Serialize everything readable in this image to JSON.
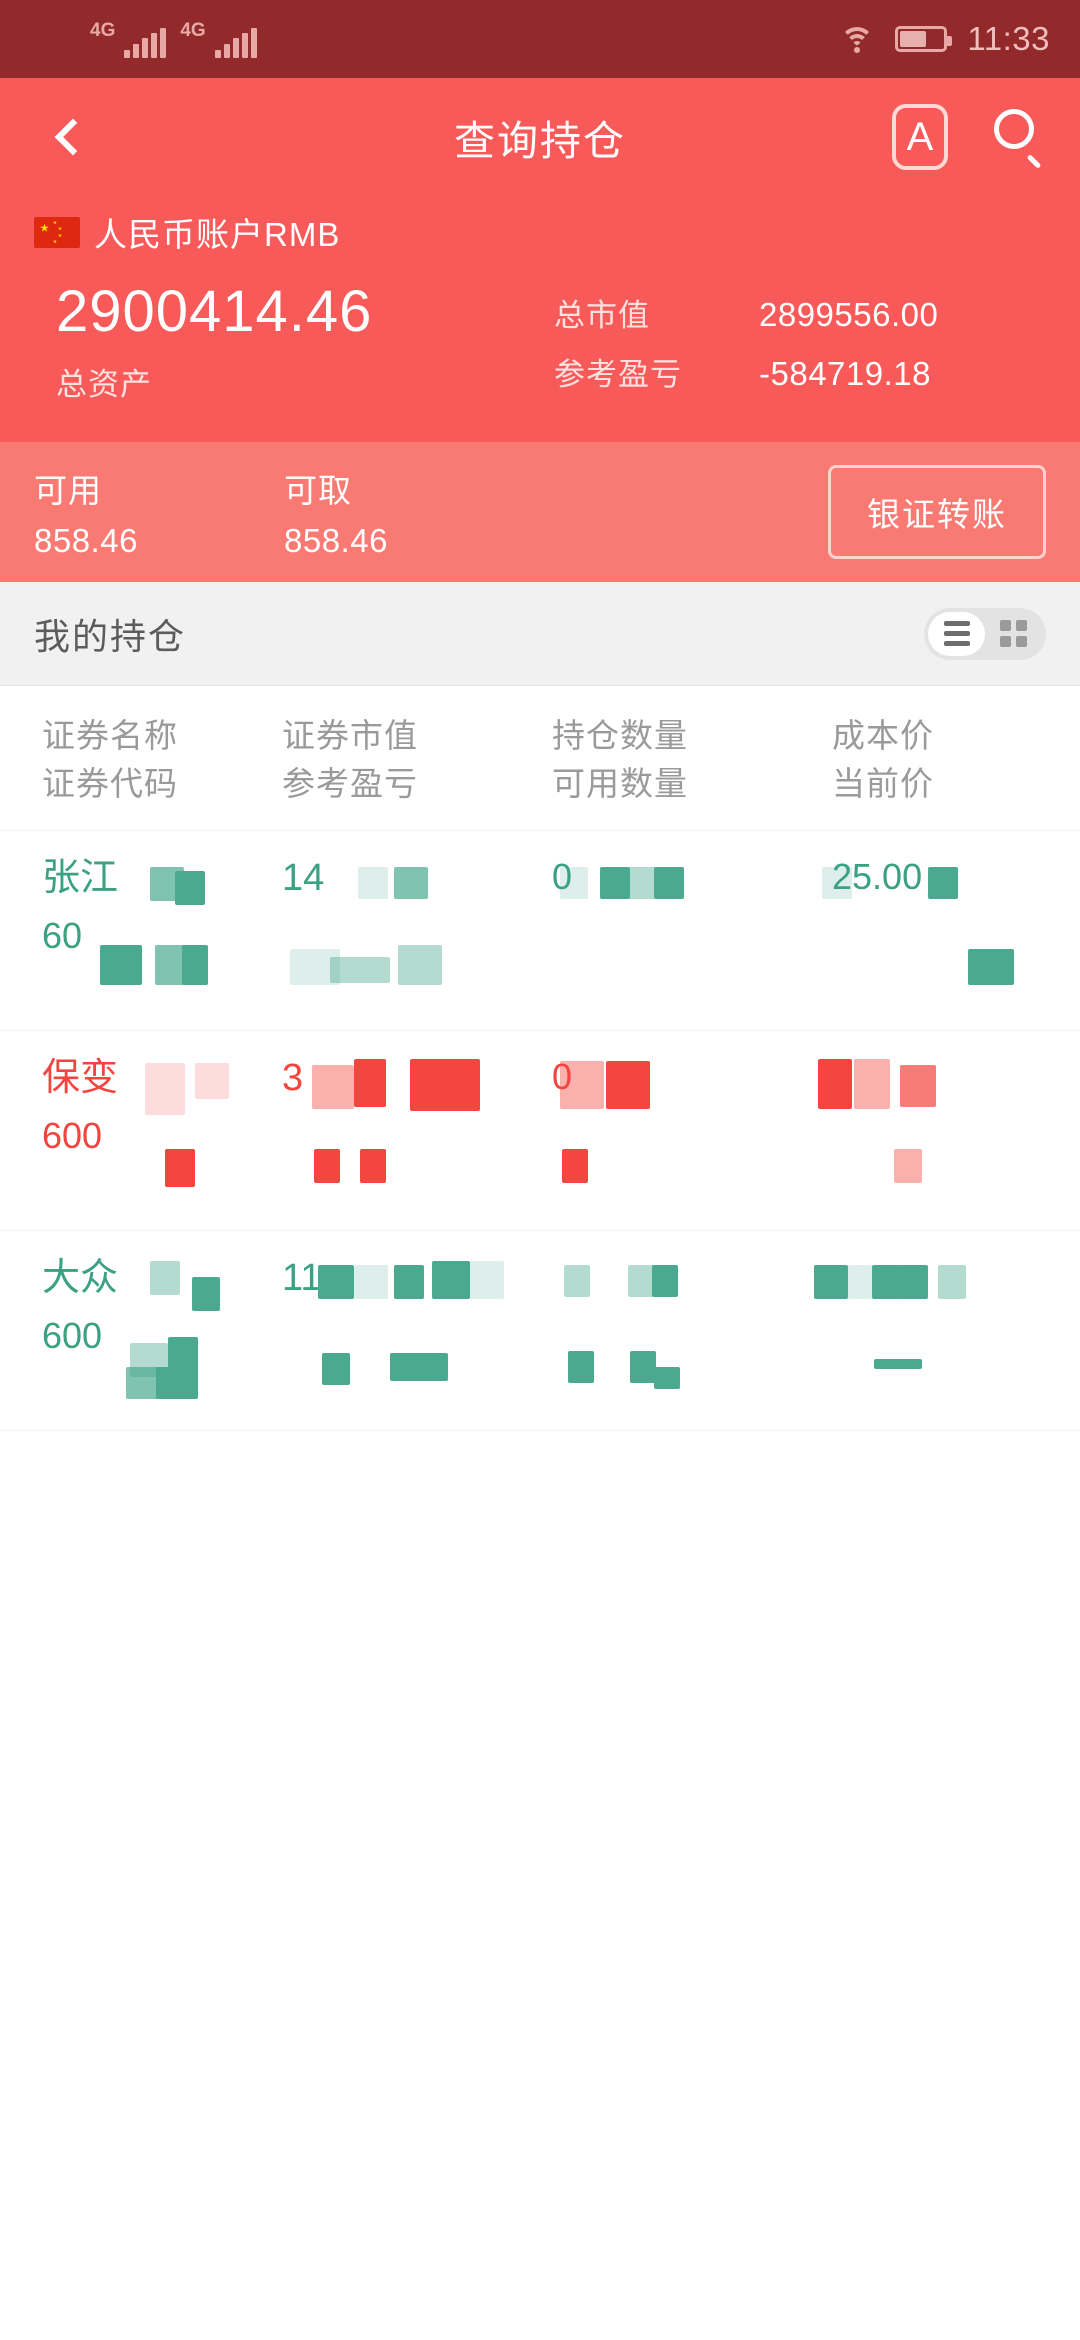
{
  "status_bar": {
    "network_1": "4G",
    "network_2": "4G",
    "wifi_icon": "wifi-icon",
    "battery_icon": "battery-icon",
    "time": "11:33"
  },
  "header": {
    "back_icon": "back-chevron-icon",
    "title": "查询持仓",
    "font_size_icon": "letter-a-icon",
    "font_size_label": "A",
    "search_icon": "search-icon",
    "background_color": "#f75a58"
  },
  "account": {
    "flag_icon": "china-flag-icon",
    "name": "人民币账户RMB",
    "total_assets_value": "2900414.46",
    "total_assets_label": "总资产",
    "market_value_label": "总市值",
    "market_value": "2899556.00",
    "profit_loss_label": "参考盈亏",
    "profit_loss": "-584719.18"
  },
  "funds": {
    "available_label": "可用",
    "available_value": "858.46",
    "withdrawable_label": "可取",
    "withdrawable_value": "858.46",
    "transfer_button": "银证转账",
    "background_color": "#f97a73"
  },
  "holdings_section": {
    "title": "我的持仓",
    "view_toggle": {
      "list_icon": "list-view-icon",
      "grid_icon": "grid-view-icon",
      "selected": "list"
    }
  },
  "table": {
    "columns": [
      {
        "line1": "证券名称",
        "line2": "证券代码"
      },
      {
        "line1": "证券市值",
        "line2": "参考盈亏"
      },
      {
        "line1": "持仓数量",
        "line2": "可用数量"
      },
      {
        "line1": "成本价",
        "line2": "当前价"
      }
    ],
    "rows": [
      {
        "direction": "down",
        "color": "#3aa183",
        "name": "张江",
        "code": "60",
        "market_value": "14",
        "profit_loss": "",
        "quantity": "",
        "available_quantity": "0",
        "cost_price": "",
        "current_price": "25.00"
      },
      {
        "direction": "up",
        "color": "#f4443f",
        "name": "保变",
        "code": "600",
        "market_value": "3",
        "profit_loss": "",
        "quantity": "",
        "available_quantity": "0",
        "cost_price": "",
        "current_price": ""
      },
      {
        "direction": "down",
        "color": "#3aa183",
        "name": "大众",
        "code": "600",
        "market_value": "11",
        "profit_loss": "",
        "quantity": "",
        "available_quantity": "",
        "cost_price": "",
        "current_price": ""
      }
    ]
  }
}
